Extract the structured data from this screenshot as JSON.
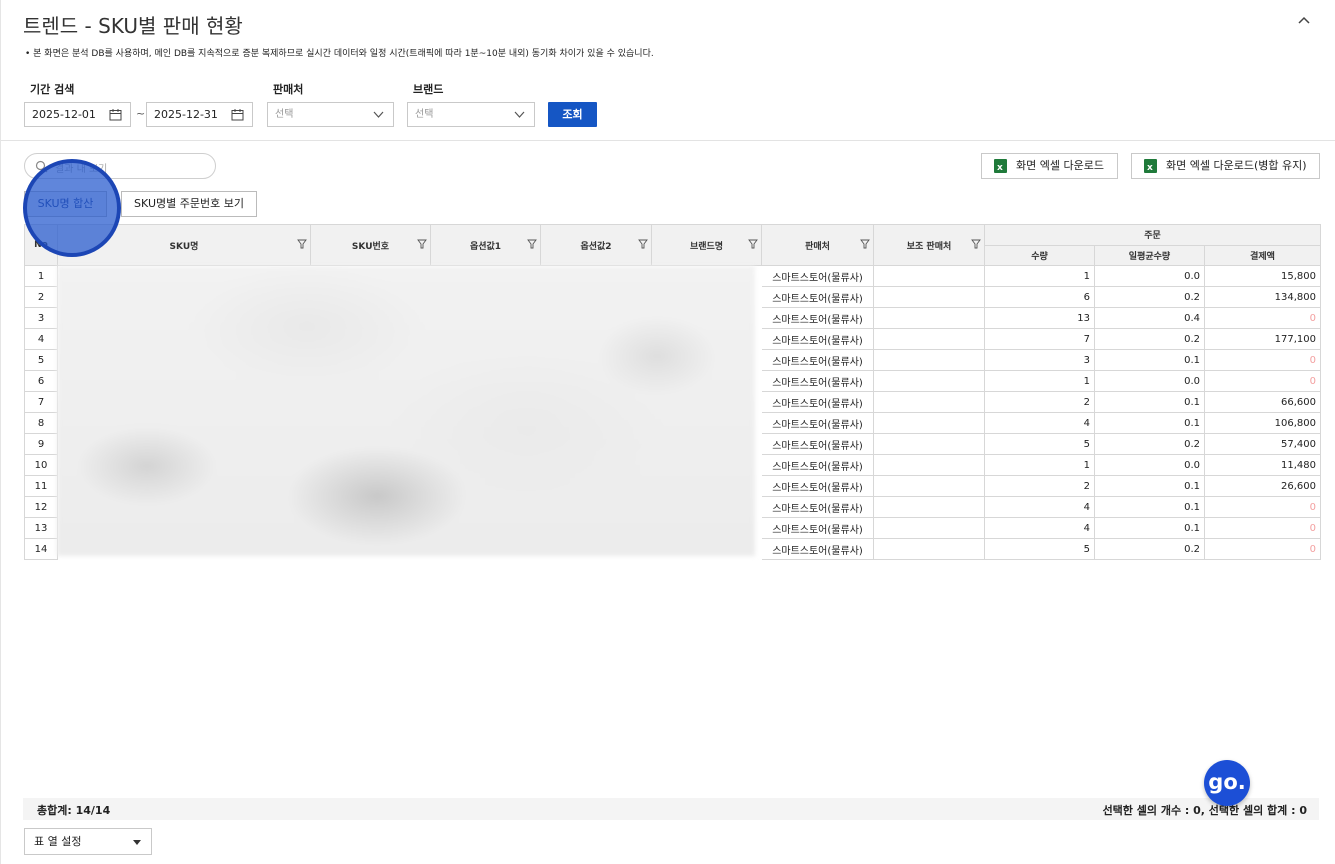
{
  "page": {
    "title": "트렌드 - SKU별 판매 현황",
    "notice": "• 본 화면은 분석 DB를 사용하며, 메인 DB를 지속적으로 증분 복제하므로 실시간 데이터와 일정 시간(트래픽에 따라 1분~10분 내외) 동기화 차이가 있을 수 있습니다."
  },
  "filters": {
    "period_label": "기간 검색",
    "date_from": "2025-12-01",
    "date_sep": "~",
    "date_to": "2025-12-31",
    "seller_label": "판매처",
    "seller_placeholder": "선택",
    "brand_label": "브랜드",
    "brand_placeholder": "선택",
    "search_button": "조회"
  },
  "toolbar": {
    "search_placeholder": "결과 내 보기",
    "excel_download": "화면 엑셀 다운로드",
    "excel_download_merged": "화면 엑셀 다운로드(병합 유지)",
    "tab_sum": "SKU명 합산",
    "tab_order": "SKU명별 주문번호 보기"
  },
  "table": {
    "headers": {
      "no": "No",
      "sku_name": "SKU명",
      "sku_no": "SKU번호",
      "option1": "옵션값1",
      "option2": "옵션값2",
      "brand": "브랜드명",
      "seller": "판매처",
      "sub_seller": "보조 판매처",
      "order_group": "주문",
      "qty": "수량",
      "avg_qty": "일평균수량",
      "amount": "결제액"
    },
    "rows": [
      {
        "no": "1",
        "seller": "스마트스토어(물류사)",
        "qty": "1",
        "avg": "0.0",
        "amount": "15,800"
      },
      {
        "no": "2",
        "seller": "스마트스토어(물류사)",
        "qty": "6",
        "avg": "0.2",
        "amount": "134,800"
      },
      {
        "no": "3",
        "seller": "스마트스토어(물류사)",
        "qty": "13",
        "avg": "0.4",
        "amount": "0"
      },
      {
        "no": "4",
        "seller": "스마트스토어(물류사)",
        "qty": "7",
        "avg": "0.2",
        "amount": "177,100"
      },
      {
        "no": "5",
        "seller": "스마트스토어(물류사)",
        "qty": "3",
        "avg": "0.1",
        "amount": "0"
      },
      {
        "no": "6",
        "seller": "스마트스토어(물류사)",
        "qty": "1",
        "avg": "0.0",
        "amount": "0"
      },
      {
        "no": "7",
        "seller": "스마트스토어(물류사)",
        "qty": "2",
        "avg": "0.1",
        "amount": "66,600"
      },
      {
        "no": "8",
        "seller": "스마트스토어(물류사)",
        "qty": "4",
        "avg": "0.1",
        "amount": "106,800"
      },
      {
        "no": "9",
        "seller": "스마트스토어(물류사)",
        "qty": "5",
        "avg": "0.2",
        "amount": "57,400"
      },
      {
        "no": "10",
        "seller": "스마트스토어(물류사)",
        "qty": "1",
        "avg": "0.0",
        "amount": "11,480"
      },
      {
        "no": "11",
        "seller": "스마트스토어(물류사)",
        "qty": "2",
        "avg": "0.1",
        "amount": "26,600"
      },
      {
        "no": "12",
        "seller": "스마트스토어(물류사)",
        "qty": "4",
        "avg": "0.1",
        "amount": "0"
      },
      {
        "no": "13",
        "seller": "스마트스토어(물류사)",
        "qty": "4",
        "avg": "0.1",
        "amount": "0"
      },
      {
        "no": "14",
        "seller": "스마트스토어(물류사)",
        "qty": "5",
        "avg": "0.2",
        "amount": "0"
      }
    ]
  },
  "footer": {
    "total": "총합계: 14/14",
    "selection": "선택한 셀의 개수 : 0, 선택한 셀의 합계 : 0",
    "column_setting": "표 열 설정"
  },
  "fab": {
    "label": "go."
  },
  "colors": {
    "primary": "#1556c4",
    "zero_value": "#f3a0a0",
    "excel_green": "#1f7a3a"
  }
}
